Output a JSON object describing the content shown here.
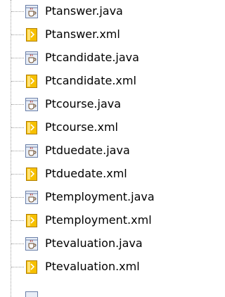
{
  "tree": {
    "files": [
      {
        "name": "Ptanswer.java",
        "type": "java",
        "icon": "java-file-icon"
      },
      {
        "name": "Ptanswer.xml",
        "type": "xml",
        "icon": "xml-file-icon"
      },
      {
        "name": "Ptcandidate.java",
        "type": "java",
        "icon": "java-file-icon"
      },
      {
        "name": "Ptcandidate.xml",
        "type": "xml",
        "icon": "xml-file-icon"
      },
      {
        "name": "Ptcourse.java",
        "type": "java",
        "icon": "java-file-icon"
      },
      {
        "name": "Ptcourse.xml",
        "type": "xml",
        "icon": "xml-file-icon"
      },
      {
        "name": "Ptduedate.java",
        "type": "java",
        "icon": "java-file-icon"
      },
      {
        "name": "Ptduedate.xml",
        "type": "xml",
        "icon": "xml-file-icon"
      },
      {
        "name": "Ptemployment.java",
        "type": "java",
        "icon": "java-file-icon"
      },
      {
        "name": "Ptemployment.xml",
        "type": "xml",
        "icon": "xml-file-icon"
      },
      {
        "name": "Ptevaluation.java",
        "type": "java",
        "icon": "java-file-icon"
      },
      {
        "name": "Ptevaluation.xml",
        "type": "xml",
        "icon": "xml-file-icon"
      }
    ],
    "partial_item_icon": "java-file-icon"
  },
  "colors": {
    "background": "#ffffff",
    "text": "#000000",
    "tree_line": "#a0a0a0",
    "java_icon_body": "#e8eef7",
    "java_icon_border": "#6a7fa8",
    "xml_icon_body": "#f6c000",
    "xml_icon_border": "#b07e00"
  }
}
